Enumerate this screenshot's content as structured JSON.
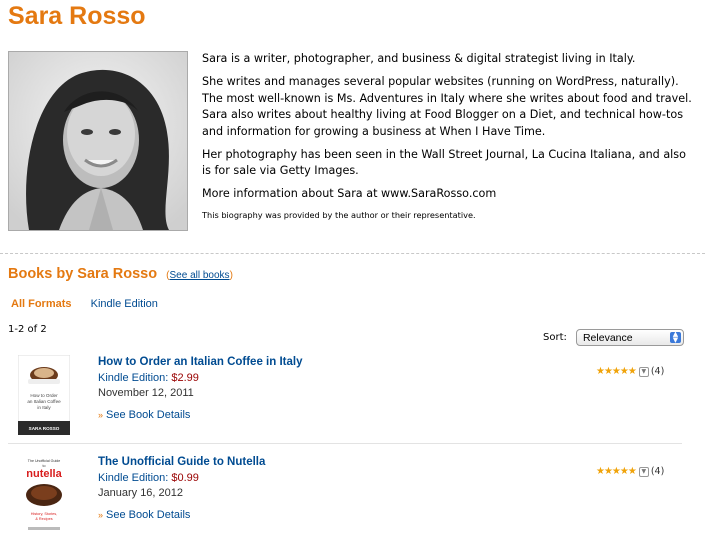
{
  "author": {
    "name": "Sara Rosso"
  },
  "bio": {
    "paragraphs": [
      "Sara is a writer, photographer, and business & digital strategist living in Italy.",
      "She writes and manages several popular websites (running on WordPress, naturally). The most well-known is Ms. Adventures in Italy where she writes about food and travel. Sara also writes about healthy living at Food Blogger on a Diet, and technical how-tos and information for growing a business at When I Have Time.",
      "Her photography has been seen in the Wall Street Journal, La Cucina Italiana, and also is for sale via Getty Images.",
      "More information about Sara at www.SaraRosso.com"
    ],
    "disclaimer": "This biography was provided by the author or their representative."
  },
  "books_section": {
    "title": "Books by Sara Rosso",
    "see_all_open": "(",
    "see_all_label": "See all books",
    "see_all_close": ")",
    "tabs": [
      "All Formats",
      "Kindle Edition"
    ],
    "result_count": "1-2 of 2",
    "sort_label": "Sort:",
    "sort_value": "Relevance"
  },
  "books": [
    {
      "title": "How to Order an Italian Coffee in Italy",
      "format_label": "Kindle Edition:",
      "price": "$2.99",
      "date": "November 12, 2011",
      "details_label": "See Book Details",
      "review_count": "(4)",
      "rating_stars": 5,
      "cover_text": [
        "How to Order",
        "an Italian Coffee",
        "in Italy",
        "SARA ROSSO"
      ]
    },
    {
      "title": "The Unofficial Guide to Nutella",
      "format_label": "Kindle Edition:",
      "price": "$0.99",
      "date": "January 16, 2012",
      "details_label": "See Book Details",
      "review_count": "(4)",
      "rating_stars": 5,
      "cover_text": [
        "The Unofficial Guide",
        "to",
        "nutella",
        "History, Stories,",
        "& Recipes"
      ]
    }
  ],
  "colors": {
    "accent": "#e47911",
    "link": "#004b91",
    "price": "#990000",
    "stars": "#f0a30a"
  }
}
